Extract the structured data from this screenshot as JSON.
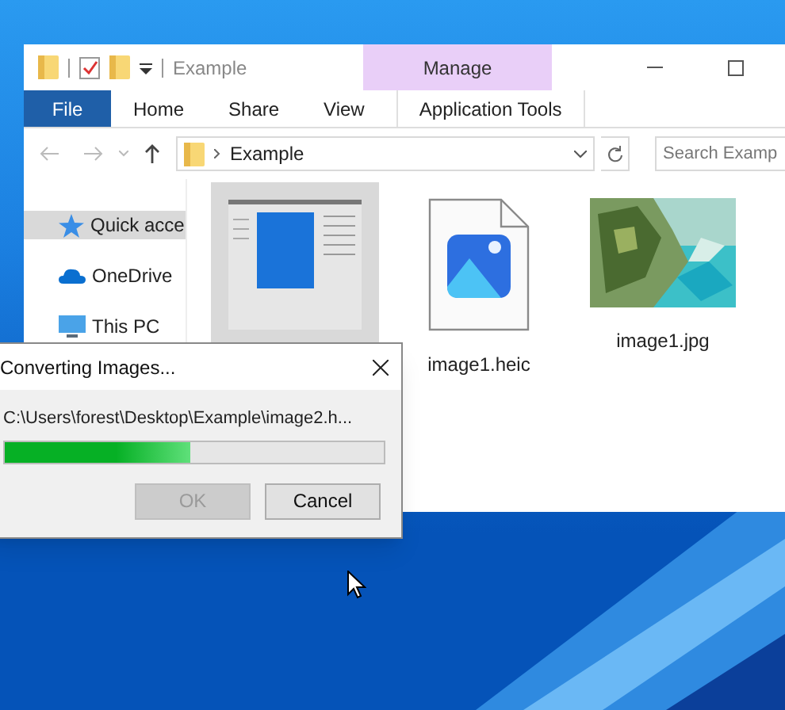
{
  "explorer": {
    "title": "Example",
    "contextual_group": "Manage",
    "ribbon_tabs": [
      {
        "label": "File",
        "kind": "file",
        "selected": false
      },
      {
        "label": "Home",
        "kind": "normal",
        "selected": false
      },
      {
        "label": "Share",
        "kind": "normal",
        "selected": false
      },
      {
        "label": "View",
        "kind": "normal",
        "selected": false
      },
      {
        "label": "Application Tools",
        "kind": "contextual",
        "selected": false
      }
    ],
    "address": {
      "breadcrumb": "Example"
    },
    "search": {
      "placeholder": "Search Examp"
    },
    "nav_items": [
      {
        "label": "Quick acce",
        "kind": "star",
        "selected": true
      },
      {
        "label": "OneDrive",
        "kind": "cloud",
        "selected": false
      },
      {
        "label": "This PC",
        "kind": "pc",
        "selected": false
      }
    ],
    "files": [
      {
        "kind": "screenshot",
        "selected": true
      },
      {
        "name": "image1.heic",
        "kind": "heic",
        "selected": false
      },
      {
        "name": "image1.jpg",
        "selected": false
      }
    ]
  },
  "dialog": {
    "title": "Converting Images...",
    "path": "C:\\Users\\forest\\Desktop\\Example\\image2.h...",
    "level": 0.49,
    "buttons": [
      {
        "label": "OK",
        "disabled": true
      },
      {
        "label": "Cancel",
        "disabled": false
      }
    ]
  }
}
